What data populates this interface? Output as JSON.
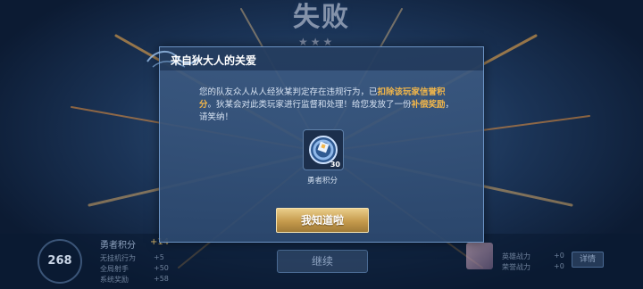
{
  "background": {
    "result_title": "失败",
    "stars": "★★★",
    "score": "268",
    "stats": {
      "title": "勇者积分",
      "total": "+14",
      "rows": [
        {
          "label": "无挂机行为",
          "value": "+5"
        },
        {
          "label": "全局射手",
          "value": "+50"
        },
        {
          "label": "系统奖励",
          "value": "+58"
        }
      ]
    },
    "continue_label": "继续",
    "right_rows": [
      {
        "label": "英雄战力",
        "value": "+0"
      },
      {
        "label": "荣誉战力",
        "value": "+0"
      }
    ],
    "detail_label": "详情"
  },
  "dialog": {
    "title": "来自狄大人的关爱",
    "body_parts": [
      {
        "text": "您的队友众人从人经狄某判定存在违规行为，已",
        "highlight": false
      },
      {
        "text": "扣除该玩家信誉积分",
        "highlight": true
      },
      {
        "text": "。狄某会对此类玩家进行监督和处理！给您发放了一份",
        "highlight": false
      },
      {
        "text": "补偿奖励",
        "highlight": true
      },
      {
        "text": "，请笑纳！",
        "highlight": false
      }
    ],
    "item": {
      "count": "30",
      "label": "勇者积分",
      "icon": "brave-points-icon"
    },
    "confirm_label": "我知道啦"
  },
  "colors": {
    "accent": "#f2b64a",
    "button_gold": "#c59a4c",
    "panel": "#3c5a82"
  }
}
